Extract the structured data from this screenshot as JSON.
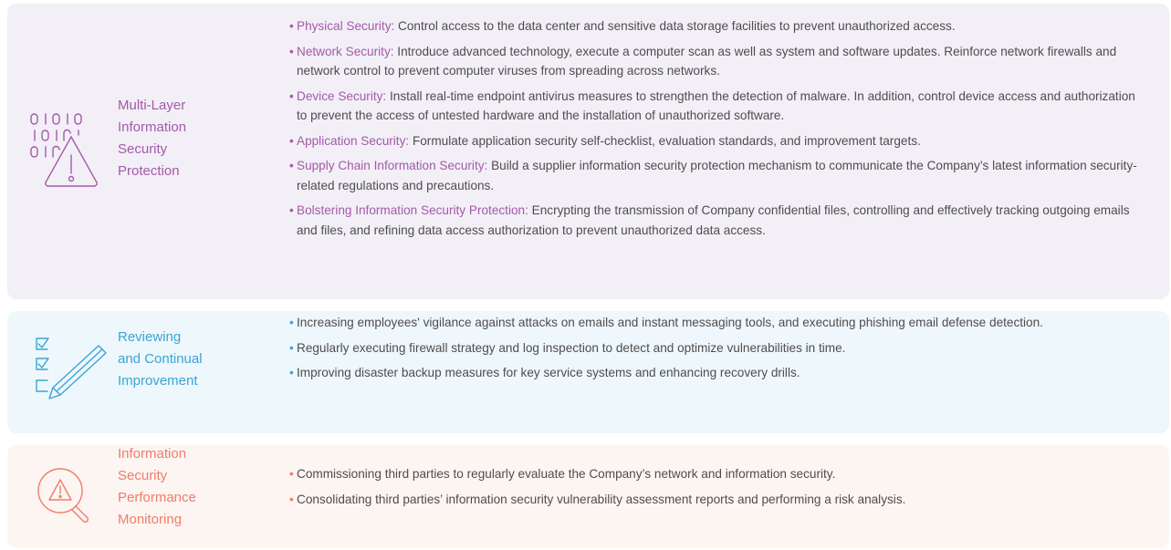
{
  "sections": [
    {
      "title_lines": [
        "Multi-Layer",
        "Information",
        "Security",
        "Protection"
      ],
      "icon": "binary-warning-icon",
      "color": "#a35aa8",
      "bg": "#f3eff7",
      "items": [
        {
          "head": "Physical Security:",
          "text": " Control access to the data center and sensitive data storage facilities to prevent unauthorized access."
        },
        {
          "head": "Network Security:",
          "text": " Introduce advanced technology, execute a computer scan as well as system and software updates. Reinforce network firewalls and network control to prevent computer viruses from spreading across networks."
        },
        {
          "head": "Device Security:",
          "text": " Install real-time endpoint antivirus measures to strengthen the detection of malware. In addition, control device access and authorization to prevent the access of untested hardware and the installation of unauthorized software."
        },
        {
          "head": "Application Security:",
          "text": " Formulate application security self-checklist, evaluation standards, and improvement targets."
        },
        {
          "head": "Supply Chain Information Security:",
          "text": " Build a supplier information security protection mechanism to communicate the Company’s latest information security-related regulations and precautions."
        },
        {
          "head": "Bolstering Information Security Protection:",
          "text": " Encrypting the transmission of Company confidential files, controlling and effectively tracking outgoing emails and files, and refining data access authorization to prevent unauthorized data access."
        }
      ]
    },
    {
      "title_lines": [
        "Reviewing",
        "and Continual",
        "Improvement"
      ],
      "icon": "checklist-pen-icon",
      "color": "#39a5d6",
      "bg": "#eef7fb",
      "items": [
        {
          "text": "Increasing employees' vigilance against attacks on emails and instant messaging tools, and executing phishing email defense detection."
        },
        {
          "text": "Regularly executing firewall strategy and log inspection to detect and optimize vulnerabilities in time."
        },
        {
          "text": "Improving disaster backup measures for key service systems and enhancing recovery drills."
        }
      ]
    },
    {
      "title_lines": [
        "Information",
        "Security",
        "Performance",
        "Monitoring"
      ],
      "icon": "magnifier-warning-icon",
      "color": "#ef7c6a",
      "bg": "#fdf5f2",
      "items": [
        {
          "text": "Commissioning third parties to regularly evaluate the Company’s network and information security."
        },
        {
          "text": "Consolidating third parties’ information security vulnerability assessment reports and performing a risk analysis."
        }
      ]
    }
  ],
  "bullet": "•"
}
